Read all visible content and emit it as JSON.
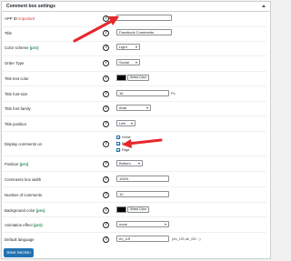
{
  "panel": {
    "title": "Comment box settings"
  },
  "help_glyph": "?",
  "rows": {
    "app_id": {
      "label": "APP ID",
      "important": "important",
      "value": ""
    },
    "title": {
      "label": "Title",
      "value": "Facebook Comments"
    },
    "color_scheme": {
      "label": "Color scheme",
      "pro": "(pro)",
      "value": "Light"
    },
    "order_type": {
      "label": "Order Type",
      "value": "Social"
    },
    "title_text_color": {
      "label": "Title text color",
      "button": "Select Color",
      "color": "#000000"
    },
    "title_font_size": {
      "label": "Title font-size",
      "value": "16",
      "unit": "Px"
    },
    "title_font_family": {
      "label": "Title font family",
      "value": "Arial"
    },
    "title_position": {
      "label": "Title position",
      "value": "Left"
    },
    "display_comments_on": {
      "label": "Display comments on",
      "options": [
        "Home",
        "Post",
        "Page"
      ]
    },
    "position": {
      "label": "Position",
      "pro": "(pro)",
      "value": "Bottom"
    },
    "comments_box_width": {
      "label": "Comments box width",
      "value": "100%"
    },
    "number_of_comments": {
      "label": "Number of comments",
      "value": "10"
    },
    "background_color": {
      "label": "Background color",
      "pro": "(pro)",
      "button": "Select Color",
      "color": "#000000"
    },
    "animation_effect": {
      "label": "Animation effect",
      "pro": "(pro)",
      "value": "none"
    },
    "default_language": {
      "label": "Default language",
      "value": "en_US",
      "hint": "(en_US,de_DE...)"
    }
  },
  "save_button": "Save Section",
  "colors": {
    "accent": "#2271b1",
    "important": "#d63638",
    "pro": "#2e8b57",
    "arrow": "#e8262a"
  }
}
